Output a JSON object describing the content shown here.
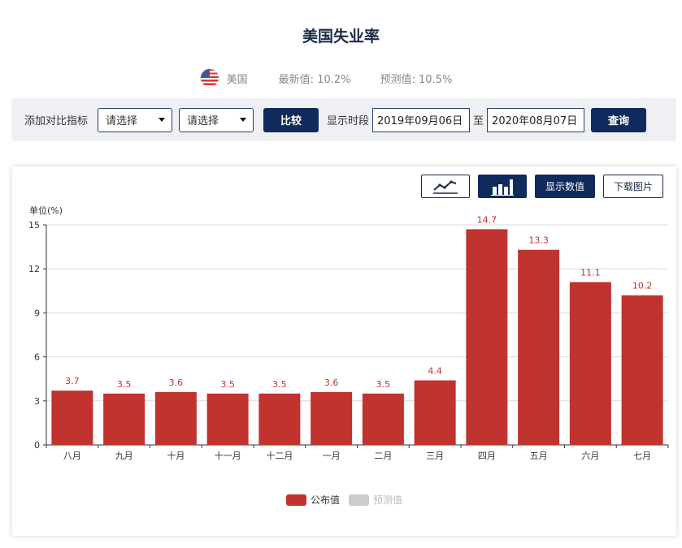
{
  "header": {
    "title": "美国失业率"
  },
  "summary": {
    "country": "美国",
    "latest_label": "最新值:",
    "latest_value": "10.2%",
    "forecast_label": "预测值:",
    "forecast_value": "10.5%"
  },
  "filter": {
    "compare_label": "添加对比指标",
    "select1": "请选择",
    "select2": "请选择",
    "compare_button": "比较",
    "period_label": "显示时段",
    "date_from": "2019年09月06日",
    "to_label": "至",
    "date_to": "2020年08月07日",
    "query_button": "查询"
  },
  "toolbar": {
    "line_icon": "line-chart-icon",
    "bar_icon": "bar-chart-icon",
    "show_values": "显示数值",
    "download": "下载图片"
  },
  "colors": {
    "bar": "#c0332f",
    "navy": "#0f2a5c",
    "forecast_legend": "#cccccc"
  },
  "chart_data": {
    "type": "bar",
    "ylabel": "单位(%)",
    "ylim": [
      0,
      15
    ],
    "yticks": [
      0,
      3,
      6,
      9,
      12,
      15
    ],
    "categories": [
      "八月",
      "九月",
      "十月",
      "十一月",
      "十二月",
      "一月",
      "二月",
      "三月",
      "四月",
      "五月",
      "六月",
      "七月"
    ],
    "series": [
      {
        "name": "公布值",
        "values": [
          3.7,
          3.5,
          3.6,
          3.5,
          3.5,
          3.6,
          3.5,
          4.4,
          14.7,
          13.3,
          11.1,
          10.2
        ],
        "color": "#c0332f"
      },
      {
        "name": "预测值",
        "values": [],
        "color": "#cccccc"
      }
    ],
    "legend_position": "bottom-center",
    "grid": true
  }
}
